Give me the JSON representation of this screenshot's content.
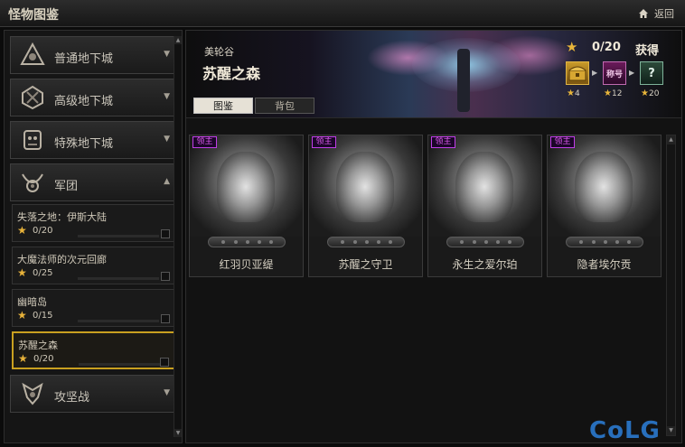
{
  "window": {
    "title": "怪物图鉴",
    "back_label": "返回"
  },
  "sidebar": {
    "items": [
      {
        "label": "普通地下城",
        "arrow": "▼"
      },
      {
        "label": "高级地下城",
        "arrow": "▼"
      },
      {
        "label": "特殊地下城",
        "arrow": "▼"
      },
      {
        "label": "军团",
        "arrow": "▲"
      },
      {
        "label": "攻坚战",
        "arrow": "▼"
      }
    ],
    "subitems": [
      {
        "name": "失落之地：伊斯大陆",
        "progress": "0/20"
      },
      {
        "name": "大魔法师的次元回廊",
        "progress": "0/25"
      },
      {
        "name": "幽暗岛",
        "progress": "0/15"
      },
      {
        "name": "苏醒之森",
        "progress": "0/20"
      }
    ]
  },
  "dungeon": {
    "region": "美轮谷",
    "name": "苏醒之森"
  },
  "reward": {
    "progress": "0/20",
    "get_label": "获得",
    "items": [
      {
        "icon": "treasure-chest-icon",
        "stars": "4"
      },
      {
        "icon": "title-badge-icon",
        "text": "称号",
        "stars": "12"
      },
      {
        "icon": "mystery-box-icon",
        "text": "?",
        "stars": "20"
      }
    ]
  },
  "tabs": [
    {
      "label": "图鉴"
    },
    {
      "label": "背包"
    }
  ],
  "monsters": [
    {
      "badge": "领主",
      "name": "红羽贝亚缇"
    },
    {
      "badge": "领主",
      "name": "苏醒之守卫"
    },
    {
      "badge": "领主",
      "name": "永生之爱尔珀"
    },
    {
      "badge": "领主",
      "name": "隐者埃尔贡"
    }
  ],
  "watermark": "CoLG"
}
